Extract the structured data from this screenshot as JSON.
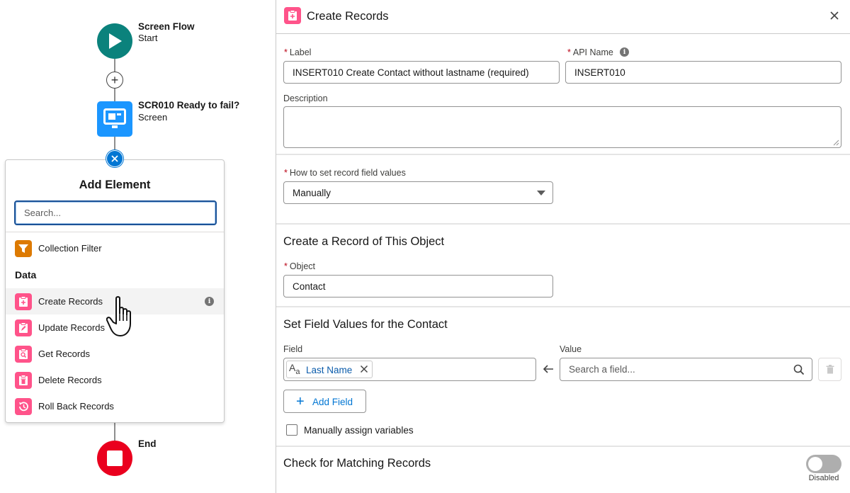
{
  "canvas": {
    "start": {
      "title": "Screen Flow",
      "subtitle": "Start"
    },
    "screen": {
      "title": "SCR010 Ready to fail?",
      "subtitle": "Screen"
    },
    "end": {
      "title": "End"
    }
  },
  "add_element": {
    "title": "Add Element",
    "search_placeholder": "Search...",
    "top_item": {
      "label": "Collection Filter",
      "icon": "filter-icon"
    },
    "section": "Data",
    "items": [
      {
        "label": "Create Records",
        "icon": "create-records-icon",
        "hovered": true
      },
      {
        "label": "Update Records",
        "icon": "update-records-icon"
      },
      {
        "label": "Get Records",
        "icon": "get-records-icon"
      },
      {
        "label": "Delete Records",
        "icon": "delete-records-icon"
      },
      {
        "label": "Roll Back Records",
        "icon": "roll-back-records-icon"
      }
    ]
  },
  "props": {
    "title": "Create Records",
    "label_field": {
      "label": "Label",
      "value": "INSERT010 Create Contact without lastname (required)"
    },
    "api_field": {
      "label": "API Name",
      "value": "INSERT010"
    },
    "description_label": "Description",
    "how_to_set": {
      "label": "How to set record field values",
      "value": "Manually"
    },
    "object_section": "Create a Record of This Object",
    "object_field": {
      "label": "Object",
      "value": "Contact"
    },
    "field_values_section": "Set Field Values for the Contact",
    "field_col_label": "Field",
    "value_col_label": "Value",
    "field_pill": "Last Name",
    "value_placeholder": "Search a field...",
    "add_field_label": "Add Field",
    "manual_assign_label": "Manually assign variables",
    "matching_section": "Check for Matching Records",
    "toggle_state": "Disabled"
  },
  "colors": {
    "start": "#0b827c",
    "screen": "#1b96ff",
    "end": "#ea001e",
    "records_pink": "#ff538a",
    "filter_orange": "#dd7a01",
    "brand_blue": "#0176d3"
  }
}
